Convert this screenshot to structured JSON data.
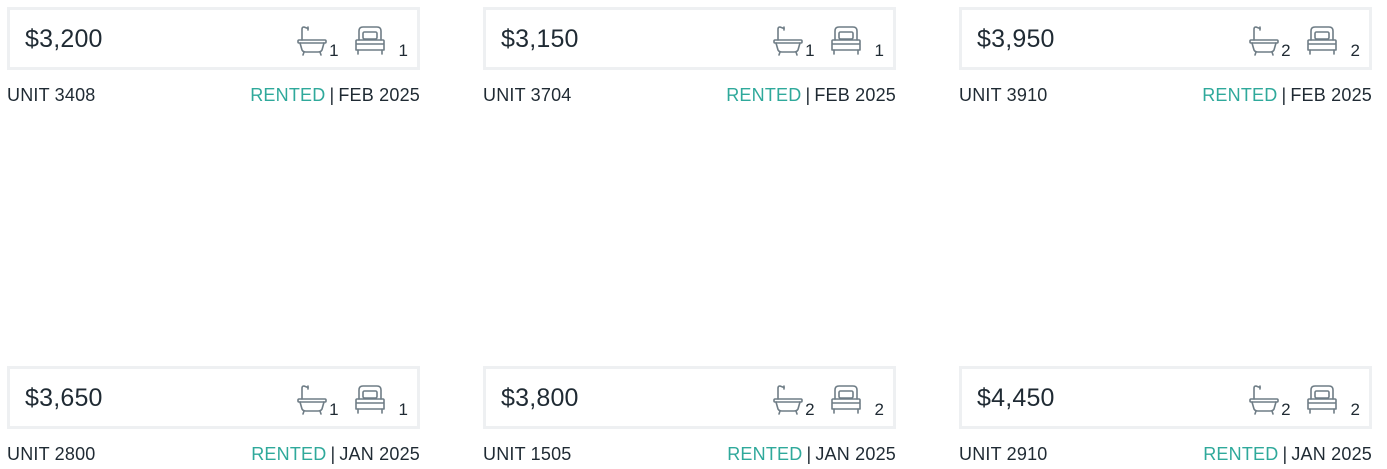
{
  "colors": {
    "accent_rented": "#2fa99b",
    "text": "#1f2a33",
    "border": "#eef0f2",
    "icon": "#6f7d86"
  },
  "icons": {
    "bath": "bathtub-icon",
    "bed": "bed-icon"
  },
  "listings": [
    {
      "price": "$3,200",
      "baths": "1",
      "beds": "1",
      "unit": "UNIT 3408",
      "status": "RENTED",
      "separator": "|",
      "date": "FEB 2025"
    },
    {
      "price": "$3,150",
      "baths": "1",
      "beds": "1",
      "unit": "UNIT 3704",
      "status": "RENTED",
      "separator": "|",
      "date": "FEB 2025"
    },
    {
      "price": "$3,950",
      "baths": "2",
      "beds": "2",
      "unit": "UNIT 3910",
      "status": "RENTED",
      "separator": "|",
      "date": "FEB 2025"
    },
    {
      "price": "$3,650",
      "baths": "1",
      "beds": "1",
      "unit": "UNIT 2800",
      "status": "RENTED",
      "separator": "|",
      "date": "JAN 2025"
    },
    {
      "price": "$3,800",
      "baths": "2",
      "beds": "2",
      "unit": "UNIT 1505",
      "status": "RENTED",
      "separator": "|",
      "date": "JAN 2025"
    },
    {
      "price": "$4,450",
      "baths": "2",
      "beds": "2",
      "unit": "UNIT 2910",
      "status": "RENTED",
      "separator": "|",
      "date": "JAN 2025"
    }
  ]
}
